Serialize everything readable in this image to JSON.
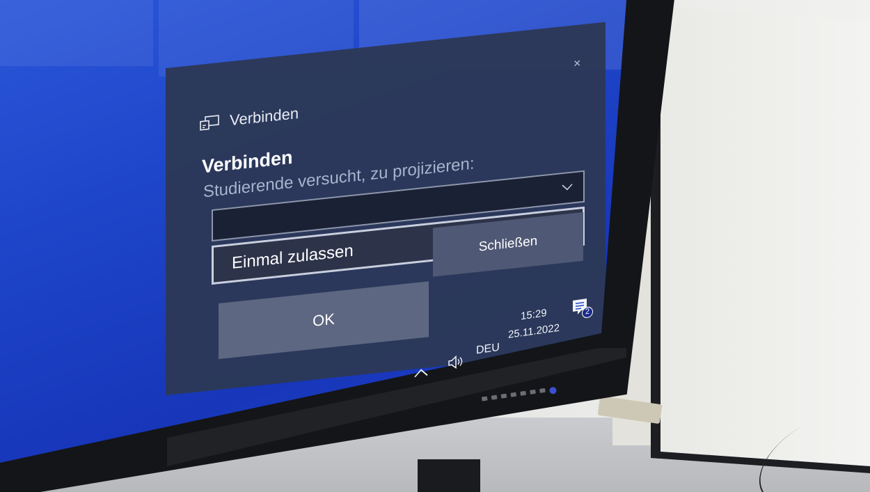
{
  "dialog": {
    "header_title": "Verbinden",
    "heading": "Verbinden",
    "subtext": "Studierende versucht, zu projizieren:",
    "device_select_value": "",
    "permission_option": "Einmal zulassen",
    "ok_label": "OK",
    "close_label": "Schließen",
    "close_icon": "×"
  },
  "taskbar": {
    "language": "DEU",
    "time": "15:29",
    "date": "25.11.2022",
    "notification_count": "2"
  },
  "icons": {
    "cast": "cast-icon",
    "chevron": "chevron-down-icon",
    "tray_chevron": "chevron-up-icon",
    "volume": "speaker-icon",
    "notifications": "notification-center-icon"
  },
  "colors": {
    "desktop": "#1e45c9",
    "dialog_bg": "#2c3856",
    "button_bg": "#5e6781"
  }
}
